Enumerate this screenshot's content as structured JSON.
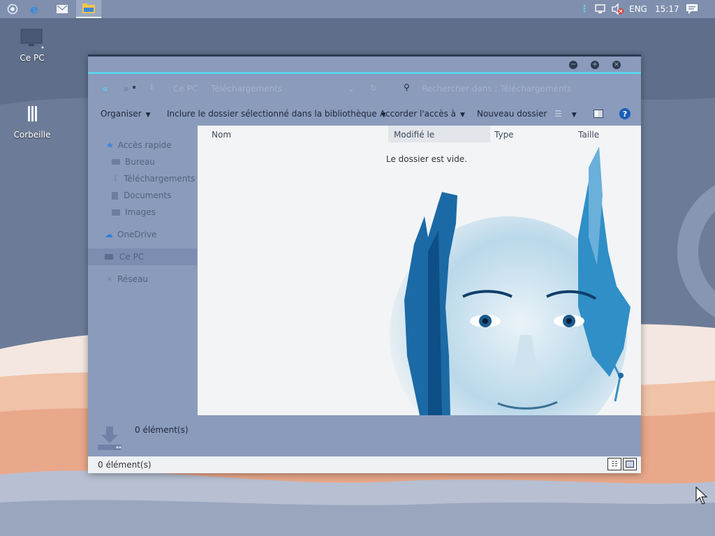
{
  "taskbar": {
    "tray": {
      "language": "ENG",
      "time": "15:17"
    }
  },
  "desktop": {
    "icons": [
      {
        "label": "Ce PC"
      },
      {
        "label": "Corbeille"
      }
    ]
  },
  "window": {
    "address": {
      "path_root": "Ce PC",
      "path_current": "Téléchargements",
      "search_placeholder": "Rechercher dans : Téléchargements"
    },
    "toolbar": {
      "organize": "Organiser",
      "include": "Inclure le dossier sélectionné dans la bibliothèque",
      "share": "Accorder l'accès à",
      "new_folder": "Nouveau dossier"
    },
    "nav": {
      "quick_access": "Accès rapide",
      "desktop": "Bureau",
      "downloads": "Téléchargements",
      "documents": "Documents",
      "images": "Images",
      "onedrive": "OneDrive",
      "this_pc": "Ce PC",
      "network": "Réseau"
    },
    "columns": {
      "name": "Nom",
      "modified": "Modifié le",
      "type": "Type",
      "size": "Taille"
    },
    "empty_message": "Le dossier est vide.",
    "details": {
      "count": "0 élément(s)"
    },
    "status": {
      "count": "0 élément(s)"
    }
  },
  "colors": {
    "accent": "#5fd1ec",
    "taskbar": "#7f8fad",
    "window": "#8a9bbc"
  }
}
